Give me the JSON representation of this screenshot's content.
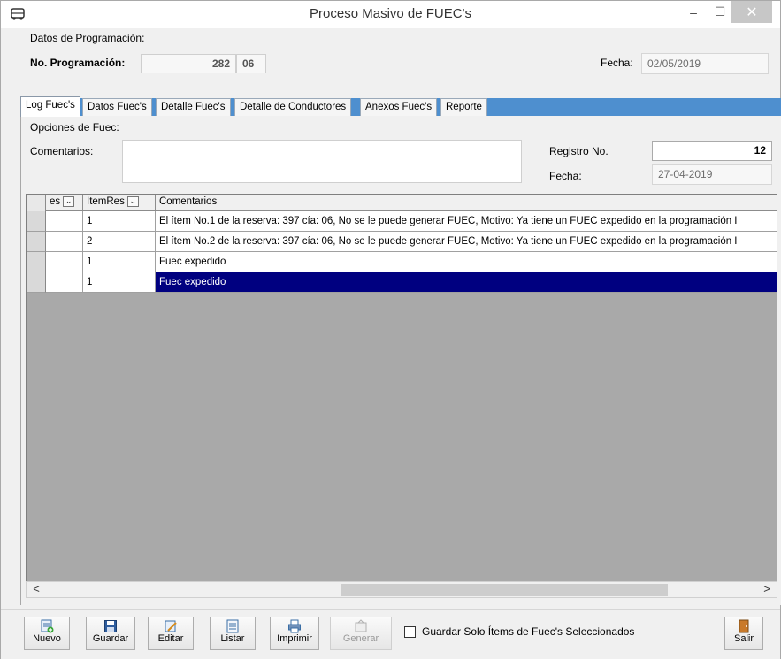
{
  "window": {
    "title": "Proceso Masivo de FUEC's",
    "minimize_glyph": "–",
    "maximize_glyph": "☐",
    "close_glyph": "✕"
  },
  "header": {
    "section_label": "Datos de Programación:",
    "programacion_label": "No. Programación:",
    "programacion_num": "282",
    "programacion_suffix": "06",
    "fecha_label": "Fecha:",
    "fecha_value": "02/05/2019"
  },
  "tabs": [
    {
      "label": "Log Fuec's",
      "active": true
    },
    {
      "label": "Datos Fuec's"
    },
    {
      "label": "Detalle Fuec's"
    },
    {
      "label": "Detalle de Conductores"
    },
    {
      "label": "Anexos Fuec's"
    },
    {
      "label": "Reporte"
    }
  ],
  "options": {
    "section_label": "Opciones de Fuec:",
    "comentarios_label": "Comentarios:",
    "comentarios_value": "",
    "registro_label": "Registro No.",
    "registro_value": "12",
    "fecha_label": "Fecha:",
    "fecha_value": "27-04-2019"
  },
  "grid": {
    "columns": [
      "es",
      "ItemRes",
      "Comentarios"
    ],
    "rows": [
      {
        "es": "",
        "item": "1",
        "comentario": "El ítem No.1 de la reserva: 397 cía: 06, No se le puede generar FUEC, Motivo:  Ya tiene un FUEC expedido en la  programación I"
      },
      {
        "es": "",
        "item": "2",
        "comentario": "El ítem No.2 de la reserva: 397 cía: 06, No se le puede generar FUEC, Motivo:  Ya tiene un FUEC expedido en la  programación I"
      },
      {
        "es": "",
        "item": "1",
        "comentario": "Fuec expedido"
      },
      {
        "es": "",
        "item": "1",
        "comentario": "Fuec expedido",
        "selected": true
      }
    ]
  },
  "scrollbar": {
    "left": "<",
    "right": ">"
  },
  "toolbar": {
    "nuevo": "Nuevo",
    "guardar": "Guardar",
    "editar": "Editar",
    "listar": "Listar",
    "imprimir": "Imprimir",
    "generar": "Generar",
    "checkbox_label": "Guardar Solo Ítems de Fuec's Seleccionados",
    "checkbox_checked": false,
    "salir": "Salir"
  },
  "colors": {
    "tabstrip": "#4e8fcf",
    "selected_row": "#000080"
  }
}
